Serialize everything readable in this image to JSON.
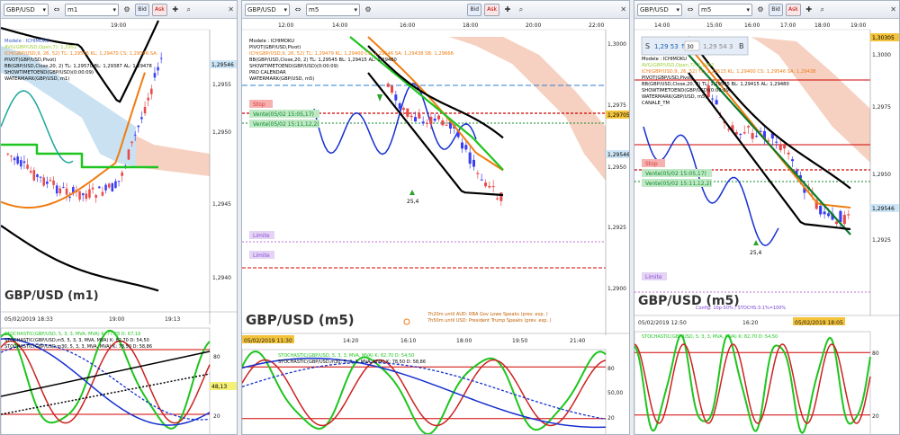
{
  "colors": {
    "up": "#3a3ff5",
    "down": "#e84a4a",
    "black": "#000000",
    "orange": "#f07c10",
    "green": "#1ec51e",
    "darkgreen": "#0a7a2a",
    "cloud": "#f4c9b6",
    "cloudBlue": "#bcd9ee",
    "red": "#d00000",
    "purple": "#8a4fd8",
    "bidask": "#2c7fd6"
  },
  "panels": [
    {
      "toolbar": {
        "symbol": "GBP/USD",
        "timeframe": "m1",
        "bid": "Bid",
        "ask": "Ask"
      },
      "time_top": [
        "19:00"
      ],
      "indicators": [
        {
          "text": "Modele : ICHIMOKU",
          "color": "#2f56c8"
        },
        {
          "text": "AVG(GBP/USD,Open,7): 1,2952",
          "color": "#9acd32"
        },
        {
          "text": "ICH(GBP/USD,9, 26, 52)  TL: 1,29515  KL: 1,29470  CS: 1,29546  SA:",
          "color": "#f07c10"
        },
        {
          "text": "PIVOT(GBP/USD,Pivot)",
          "color": "#000000"
        },
        {
          "text": "BB(GBP/USD,Close,20, 2)  TL: 1,29570  BL: 1,29387  AL: 1,29478",
          "color": "#000000"
        },
        {
          "text": "SHOWTIMETOEND(GBP/USD)(0:00:09)",
          "color": "#000000"
        },
        {
          "text": "WATERMARK(GBP/USD, m1)",
          "color": "#000000"
        }
      ],
      "price_axis": [
        "1,2955",
        "1,2950",
        "1,2945",
        "1,2940"
      ],
      "price_tag": "1,29546",
      "watermark": "GBP/USD (m1)",
      "time_bottom": [
        "05/02/2019 18:33",
        "19:00",
        "19:13"
      ],
      "stoch_labels": [
        {
          "text": "STOCHASTIC(GBP/USD, 5, 3, 3, MVA, MVA)  K: 77,78  D: 67,19",
          "color": "#1ec51e"
        },
        {
          "text": "STOCHASTIC(GBP/USD,m5, 5, 3, 3, MVA, MVA)  K: 82,70  D: 54,50",
          "color": "#000000"
        },
        {
          "text": "STOCHASTIC(GBP/USD,m30, 5, 3, 3, MVA, MVA)  K: 78,50  D: 58,86",
          "color": "#000000"
        }
      ],
      "stoch_axis": [
        "80",
        "20"
      ],
      "stoch_tag": "48,13"
    },
    {
      "toolbar": {
        "symbol": "GBP/USD",
        "timeframe": "m5",
        "bid": "Bid",
        "ask": "Ask"
      },
      "time_top": [
        "12:00",
        "14:00",
        "16:00",
        "18:00",
        "20:00",
        "22:00"
      ],
      "indicators": [
        {
          "text": "Modele : ICHIMOKU",
          "color": "#000000"
        },
        {
          "text": "PIVOT(GBP/USD,Pivot)",
          "color": "#000000"
        },
        {
          "text": "ICH(GBP/USD,9, 26, 52)  TL: 1,29479  KL: 1,29400  CS: 1,29546  SA: 1,29438  SB: 1,29668",
          "color": "#f07c10"
        },
        {
          "text": "BB(GBP/USD,Close,20, 2)  TL: 1,29545  BL: 1,29415  AL: 1,29480",
          "color": "#000000"
        },
        {
          "text": "SHOWTIMETOEND(GBP/USD)(0:00:09)",
          "color": "#000000"
        },
        {
          "text": "PRO CALENDAR",
          "color": "#000000"
        },
        {
          "text": "WATERMARK(GBP/USD, m5)",
          "color": "#000000"
        }
      ],
      "price_axis": [
        "1,3000",
        "1,2975",
        "1,2950",
        "1,2925",
        "1,2900"
      ],
      "price_tag_red": "1,29705",
      "price_tag": "1,29546",
      "orders": [
        {
          "text": "Stop",
          "color": "#d43b3b"
        },
        {
          "text": "Vente(05/02 15:05,17)",
          "color": "#0e8a2e"
        },
        {
          "text": "Vente(05/02 15:11,12,2)",
          "color": "#0e8a2e"
        }
      ],
      "limits": [
        "Limite",
        "Limite"
      ],
      "label_254": "25,4",
      "news": [
        "7h20m until AUD: RBA Gov Lowe Speaks (prev. exp. )",
        "7h50m until USD: President Trump Speaks (prev. exp. )"
      ],
      "watermark": "GBP/USD (m5)",
      "time_bottom": [
        "05/02/2019 11:30",
        "14:20",
        "16:10",
        "18:00",
        "19:50",
        "21:40"
      ],
      "stoch_labels": [
        {
          "text": "STOCHASTIC(GBP/USD, 5, 3, 3, MVA, MVA)  K: 82,70  D: 54,50",
          "color": "#1ec51e"
        },
        {
          "text": "STOCHASTIC(GBP/USD,m30, 5, 3, 3, MVA, MVA)  K: 78,50  D: 58,86",
          "color": "#000000"
        }
      ],
      "stoch_axis": [
        "80",
        "50,00",
        "20"
      ]
    },
    {
      "toolbar": {
        "symbol": "GBP/USD",
        "timeframe": "m5",
        "bid": "Bid",
        "ask": "Ask"
      },
      "time_top": [
        "14:00",
        "15:00",
        "16:00",
        "17:00",
        "18:00",
        "19:00"
      ],
      "trade_box": {
        "s": "S",
        "sell": "1,29 53 ↑",
        "qty": "30",
        "buy": "1,29 54 3",
        "b": "B"
      },
      "indicators": [
        {
          "text": "Modele : ICHIMOKU",
          "color": "#000000"
        },
        {
          "text": "AVG(GBP/USD,Open,7): 1,2952",
          "color": "#9acd32"
        },
        {
          "text": "ICH(GBP/USD,9, 26, 52)  TL: 1,29515  KL: 1,29400  CS: 1,29546  SA: 1,29438",
          "color": "#f07c10"
        },
        {
          "text": "PIVOT(GBP/USD,Pivot)",
          "color": "#000000"
        },
        {
          "text": "BB(GBP/USD,Close,20, 2)  TL: 1,29545  BL: 1,29415  AL: 1,29480",
          "color": "#000000"
        },
        {
          "text": "SHOWTIMETOEND(GBP/USD)(0:00:09)",
          "color": "#000000"
        },
        {
          "text": "WATERMARK(GBP/USD, m5)",
          "color": "#000000"
        },
        {
          "text": "CANALE_TM",
          "color": "#000000"
        }
      ],
      "price_axis": [
        "1,3000",
        "1,2975",
        "1,2950",
        "1,2925"
      ],
      "price_tag_red": "1,30305",
      "price_tag": "1,29546",
      "orders": [
        {
          "text": "Stop",
          "color": "#d43b3b"
        },
        {
          "text": "Vente(05/02 15:05,17)",
          "color": "#0e8a2e"
        },
        {
          "text": "Vente(05/02 15:11,12,2)",
          "color": "#0e8a2e"
        }
      ],
      "limits": [
        "Limite"
      ],
      "label_254": "25,4",
      "config": "Config: 10p-50% / STOCHS:3:1%=100%",
      "watermark": "GBP/USD (m5)",
      "time_bottom": [
        "05/02/2019 12:50",
        "16:20",
        "05/02/2019 18:05"
      ],
      "stoch_labels": [
        {
          "text": "STOCHASTIC(GBP/USD, 5, 3, 3, MVA, MVA)  K: 82,70  D: 54,50",
          "color": "#1ec51e"
        }
      ],
      "stoch_axis": [
        "80",
        "20"
      ]
    }
  ]
}
